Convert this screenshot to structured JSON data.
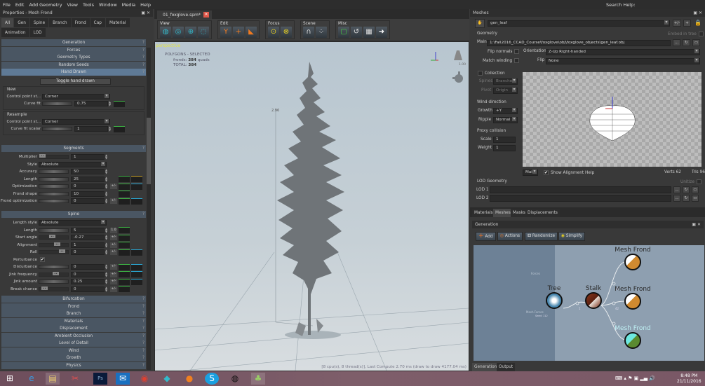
{
  "menu": [
    "File",
    "Edit",
    "Add Geometry",
    "View",
    "Tools",
    "Window",
    "Media",
    "Help"
  ],
  "search_label": "Search Help:",
  "left": {
    "title": "Properties - Mesh Frond",
    "tabs": [
      "All",
      "Gen",
      "Spine",
      "Branch",
      "Frond",
      "Cap",
      "Material",
      "Animation",
      "LOD"
    ],
    "top_sections": [
      "Generation",
      "Forces",
      "Geometry Types",
      "Random Seeds",
      "Hand Drawn"
    ],
    "toggle_label": "Toggle hand drawn",
    "new_group": {
      "title": "New",
      "cp_label": "Control point st...",
      "cp_value": "Corner",
      "fit_label": "Curve fit",
      "fit_value": "0.75"
    },
    "resample_group": {
      "title": "Resample",
      "cp_label": "Control point st...",
      "cp_value": "Corner",
      "fit_label": "Curve fit scalar",
      "fit_value": "1"
    },
    "segments": {
      "title": "Segments",
      "rows": [
        {
          "label": "Multiplier",
          "type": "knob",
          "value": "1"
        },
        {
          "label": "Style",
          "type": "dd",
          "value": "Absolute"
        },
        {
          "label": "Accuracy",
          "type": "slider",
          "value": "50"
        },
        {
          "label": "Length",
          "type": "slider",
          "value": "25",
          "curves": [
            "g",
            "y"
          ]
        },
        {
          "label": "Optimization",
          "type": "slider",
          "value": "0",
          "pm": "+/-",
          "curves": [
            "g",
            "b"
          ]
        },
        {
          "label": "Frond shape",
          "type": "slider",
          "value": "10",
          "curves": [
            "g"
          ]
        },
        {
          "label": "Frond optimization",
          "type": "slider",
          "value": "0",
          "pm": "+/-",
          "curves": [
            "g",
            "b"
          ]
        }
      ]
    },
    "spine": {
      "title": "Spine",
      "rows": [
        {
          "label": "Length style",
          "type": "dd",
          "value": "Absolute"
        },
        {
          "label": "Length",
          "type": "slider",
          "value": "5",
          "pm": "1.0",
          "curves": [
            "g"
          ]
        },
        {
          "label": "Start angle",
          "type": "knob",
          "value": "-0.27",
          "pm": "+/-",
          "curves": [
            "g"
          ]
        },
        {
          "label": "Alignment",
          "type": "knob",
          "value": "1",
          "pm": "+/-",
          "curves": [
            "g"
          ]
        },
        {
          "label": "Roll",
          "type": "knob",
          "value": "0",
          "pm": "+/-",
          "curves": [
            "g",
            "b"
          ]
        },
        {
          "label": "Perturbance",
          "type": "check",
          "value": "✔"
        },
        {
          "label": "Disturbance",
          "type": "slider",
          "value": "0",
          "pm": "+/-",
          "curves": [
            "g",
            "b"
          ]
        },
        {
          "label": "Jink frequency",
          "type": "knob",
          "value": "0",
          "pm": "+/-",
          "curves": [
            "g",
            "b"
          ]
        },
        {
          "label": "Jink amount",
          "type": "slider",
          "value": "0.25",
          "pm": "+/-",
          "curves": [
            "g",
            "b"
          ]
        },
        {
          "label": "Break chance",
          "type": "knob",
          "value": "0",
          "pm": "+/-",
          "curves": [
            "g"
          ]
        }
      ]
    },
    "bottom_sections": [
      "Bifurcation",
      "Frond",
      "Branch",
      "Materials",
      "Displacement",
      "Ambient Occlusion",
      "Level of Detail",
      "Wind",
      "Growth",
      "Physics"
    ]
  },
  "center": {
    "doc_tab": "01_foxglove.spm*",
    "toolbar_groups": [
      {
        "label": "View",
        "icons": [
          "globe-icon",
          "orbit-icon",
          "zoom-icon",
          "target-icon"
        ]
      },
      {
        "label": "Edit",
        "icons": [
          "select-icon",
          "move-icon",
          "rotate-icon"
        ]
      },
      {
        "label": "Focus",
        "icons": [
          "focus-icon",
          "focus-all-icon"
        ]
      },
      {
        "label": "Scene",
        "icons": [
          "forces-icon",
          "particles-icon"
        ]
      },
      {
        "label": "Misc",
        "icons": [
          "frame-icon",
          "reset-icon",
          "screenshot-icon",
          "export-icon"
        ]
      }
    ],
    "viewport": {
      "mode": "perspective",
      "stats_title": "POLYGONS - SELECTED",
      "fronds_label": "fronds:",
      "fronds_value": "384",
      "fronds_unit": "quads",
      "total_label": "TOTAL:",
      "total_value": "384",
      "height_label": "2.96",
      "light_value": "1.00",
      "status": "[8 cpu(s), 8 thread(s)], Last Compute 2.70 ms (draw to draw 4177.04 ms)"
    }
  },
  "right": {
    "title": "Meshes",
    "mesh_name": "gen_leaf",
    "pm": "+/-",
    "geometry_label": "Geometry",
    "embed_label": "Embed in tree",
    "main_label": "Main",
    "main_path": "1:\\Fall2016_CCAD_Course\\foxglove\\obj\\foxglove_objects\\gen_leaf.obj",
    "browse": "...",
    "flip_normals": "Flip normals",
    "match_winding": "Match winding",
    "orientation_label": "Orientation",
    "orientation_value": "Z-Up Right-handed",
    "flip_label": "Flip",
    "flip_value": "None",
    "collection": "Collection",
    "spines_label": "Spines",
    "spines_value": "Branches",
    "pivot_label": "Pivot",
    "pivot_value": "Origin",
    "wind_title": "Wind direction",
    "growth_label": "Growth",
    "growth_value": "+Y",
    "ripple_label": "Ripple",
    "ripple_value": "Normal",
    "proxy_title": "Proxy collision",
    "scale_label": "Scale",
    "scale_value": "1",
    "weight_label": "Weight",
    "weight_value": "1",
    "preview_mode": "Main",
    "align_help": "Show Alignment Help",
    "verts": "Verts 62",
    "tris": "Tris 96",
    "lod_title": "LOD Geometry",
    "unitize": "Unitize",
    "lod1": "LOD 1",
    "lod2": "LOD 2",
    "tabs": [
      "Materials",
      "Meshes",
      "Masks",
      "Displacements"
    ],
    "gen_title": "Generation",
    "gen_buttons": [
      "Add",
      "Actions",
      "Randomize",
      "Simplify"
    ],
    "nodes": {
      "tree": "Tree",
      "stalk": "Stalk",
      "frond1": "Mesh Frond",
      "frond2": "Mesh Frond",
      "frond3": "Mesh Frond",
      "forces": "Forces",
      "mesh_forces": "Mesh Forces",
      "tree_sub": "Seed: 112",
      "link1": "1",
      "link2": "80",
      "link3": "42",
      "link4": "8"
    },
    "bottom_tabs": [
      "Generation",
      "Output"
    ]
  },
  "taskbar": {
    "time": "8:48 PM",
    "date": "21/11/2016",
    "apps": [
      "windows-start-icon",
      "internet-explorer-icon",
      "file-explorer-icon",
      "snipping-tool-icon",
      "photoshop-icon",
      "mail-icon",
      "chrome-icon",
      "app-icon",
      "firefox-icon",
      "skype-icon",
      "obs-icon",
      "speedtree-icon"
    ],
    "ps": "Ps",
    "s": "S"
  },
  "colors": {
    "accent_green": "#3cb043",
    "accent_blue": "#2aa5d0",
    "header": "#4a5663",
    "header_active": "#5f7a96",
    "viewport": "#b8c6d0"
  }
}
